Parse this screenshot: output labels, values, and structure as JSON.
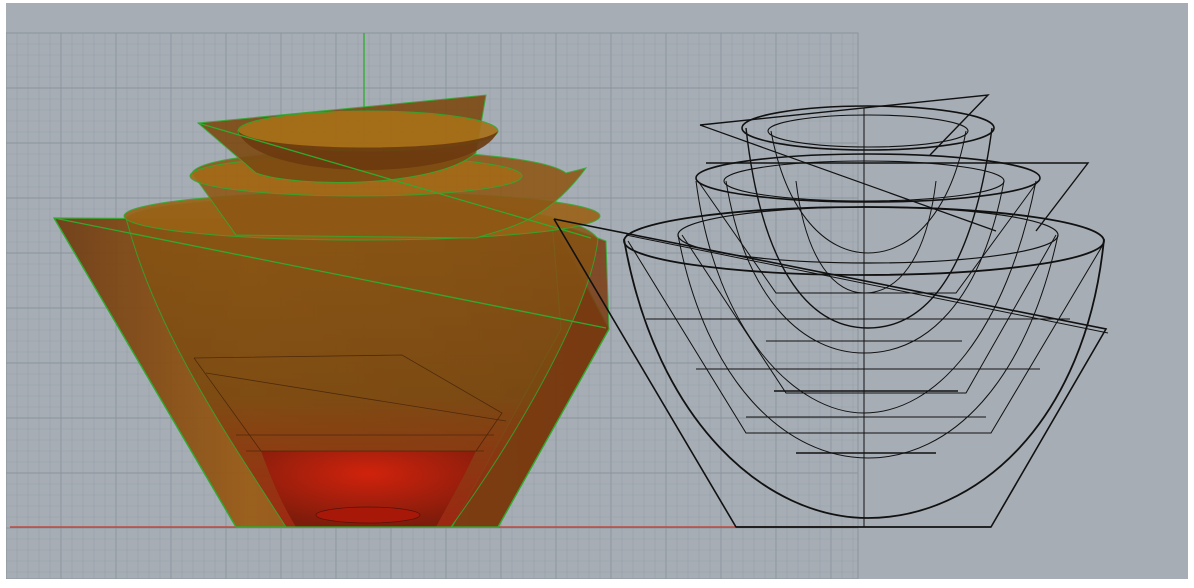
{
  "viewport": {
    "background": "#a6adb5",
    "grid_minor": "#98a0a9",
    "grid_major": "#8b939c",
    "x_axis_color": "#c0392b",
    "y_axis_color": "#22b022"
  },
  "shaded_model": {
    "surface_color": "#9a5a12",
    "bottom_color": "#b81a0a",
    "edge_color": "#2faa2f"
  },
  "wireframe_model": {
    "curve_color": "#111111"
  }
}
